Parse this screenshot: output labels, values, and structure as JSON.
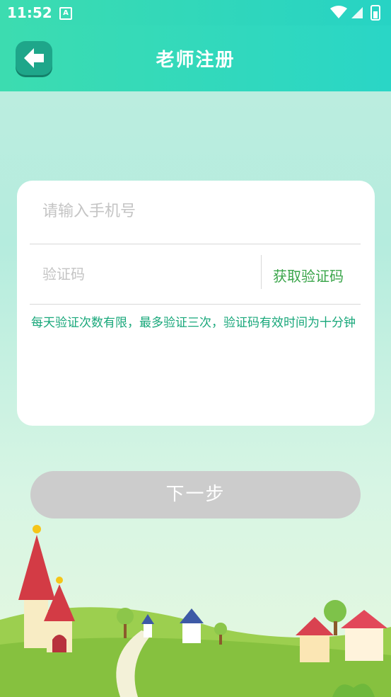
{
  "status_bar": {
    "time": "11:52",
    "app_icon_letter": "A"
  },
  "header": {
    "title": "老师注册",
    "back_icon": "arrow-left-icon"
  },
  "form": {
    "phone_placeholder": "请输入手机号",
    "code_placeholder": "验证码",
    "get_code_label": "获取验证码",
    "note": "每天验证次数有限，最多验证三次，验证码有效时间为十分钟"
  },
  "next_label": "下一步",
  "colors": {
    "header_start": "#3cdcb0",
    "header_end": "#2ad6c6",
    "accent_green": "#3aa54a",
    "note_text": "#18a77a",
    "button_disabled": "#cccccc"
  }
}
